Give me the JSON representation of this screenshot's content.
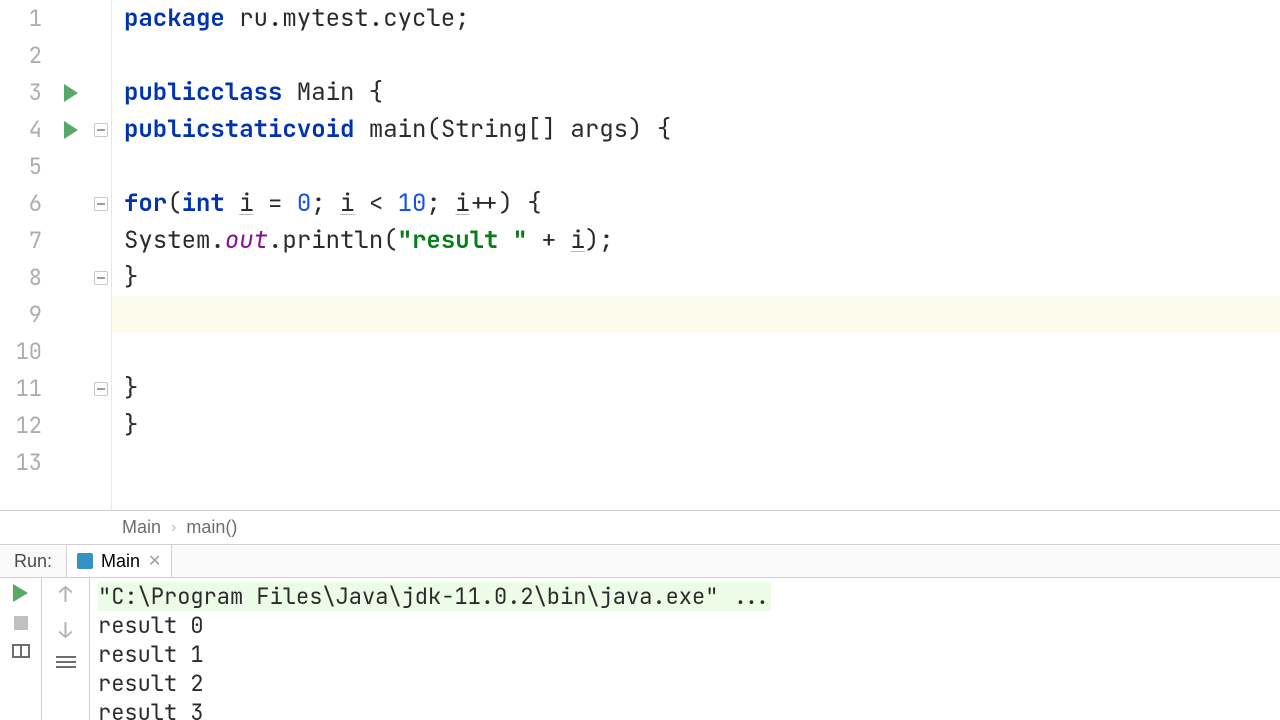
{
  "editor": {
    "lines": {
      "count": 13,
      "run_markers_at": [
        3,
        4
      ],
      "fold_markers_at": [
        4,
        6,
        8,
        11
      ],
      "current_line": 9
    },
    "code": {
      "l1_kw": "package",
      "l1_rest": " ru.mytest.cycle;",
      "l3_kw1": "public",
      "l3_kw2": "class",
      "l3_name": " Main {",
      "l4_kw1": "public",
      "l4_kw2": "static",
      "l4_kw3": "void",
      "l4_name": " main(String[] args) {",
      "l6_kw1": "for",
      "l6_p1": "(",
      "l6_kw2": "int",
      "l6_sp": " ",
      "l6_i1": "i",
      "l6_p2": " = ",
      "l6_n0": "0",
      "l6_p3": "; ",
      "l6_i2": "i",
      "l6_p4": " < ",
      "l6_n10": "10",
      "l6_p5": "; ",
      "l6_i3": "i",
      "l6_p6": "++) {",
      "l7_sys": "System.",
      "l7_out": "out",
      "l7_print": ".println(",
      "l7_str": "\"result \"",
      "l7_plus": " + ",
      "l7_i": "i",
      "l7_end": ");",
      "l8_brace": "}",
      "l11_brace": "}",
      "l12_brace": "}"
    }
  },
  "breadcrumb": {
    "a": "Main",
    "b": "main()"
  },
  "run_panel": {
    "label": "Run:",
    "tab_name": "Main",
    "console": {
      "cmd": "\"C:\\Program Files\\Java\\jdk-11.0.2\\bin\\java.exe\" ...",
      "out": [
        "result 0",
        "result 1",
        "result 2",
        "result 3"
      ]
    }
  }
}
